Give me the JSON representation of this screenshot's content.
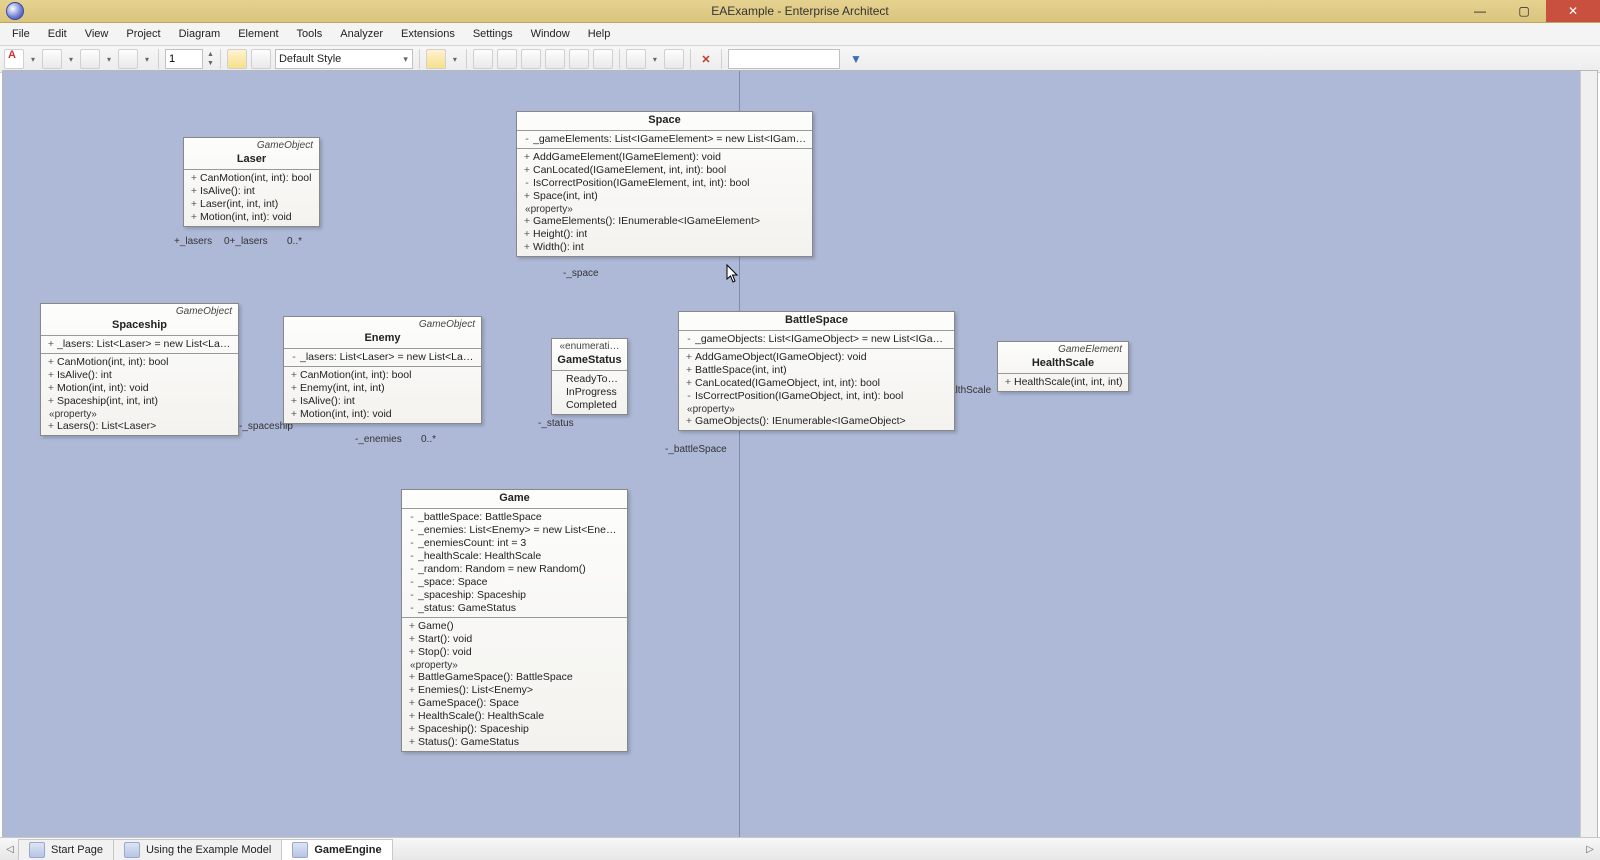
{
  "window": {
    "title": "EAExample - Enterprise Architect"
  },
  "menu": [
    "File",
    "Edit",
    "View",
    "Project",
    "Diagram",
    "Element",
    "Tools",
    "Analyzer",
    "Extensions",
    "Settings",
    "Window",
    "Help"
  ],
  "toolbar": {
    "spin_value": "1",
    "style_combo": "Default Style"
  },
  "tabs": [
    {
      "label": "Start Page",
      "active": false
    },
    {
      "label": "Using the Example Model",
      "active": false
    },
    {
      "label": "GameEngine",
      "active": true
    }
  ],
  "role_labels": {
    "lasers_left": "+_lasers",
    "lasers_mult": "0+_lasers",
    "lasers_star": "0..*",
    "spaceship": "-_spaceship",
    "enemies": "-_enemies",
    "enemies_mult": "0..*",
    "status": "-_status",
    "space": "-_space",
    "battleSpace": "-_battleSpace",
    "healthScale": "-_healthScale"
  },
  "classes": {
    "laser": {
      "stereo": "GameObject",
      "name": "Laser",
      "ops": [
        {
          "v": "+",
          "s": "CanMotion(int, int): bool"
        },
        {
          "v": "+",
          "s": "IsAlive(): int"
        },
        {
          "v": "+",
          "s": "Laser(int, int, int)"
        },
        {
          "v": "+",
          "s": "Motion(int, int): void"
        }
      ]
    },
    "space": {
      "stereo": "",
      "name": "Space",
      "attrs": [
        {
          "v": "-",
          "s": "_gameElements: List<IGameElement> = new List<IGameE..."
        }
      ],
      "ops": [
        {
          "v": "+",
          "s": "AddGameElement(IGameElement): void"
        },
        {
          "v": "+",
          "s": "CanLocated(IGameElement, int, int): bool"
        },
        {
          "v": "-",
          "s": "IsCorrectPosition(IGameElement, int, int): bool"
        },
        {
          "v": "+",
          "s": "Space(int, int)"
        }
      ],
      "prop_label": "property",
      "props": [
        {
          "v": "+",
          "s": "GameElements(): IEnumerable<IGameElement>"
        },
        {
          "v": "+",
          "s": "Height(): int"
        },
        {
          "v": "+",
          "s": "Width(): int"
        }
      ]
    },
    "spaceship": {
      "stereo": "GameObject",
      "name": "Spaceship",
      "attrs": [
        {
          "v": "+",
          "s": "_lasers: List<Laser> = new List<Laser>()"
        }
      ],
      "ops": [
        {
          "v": "+",
          "s": "CanMotion(int, int): bool"
        },
        {
          "v": "+",
          "s": "IsAlive(): int"
        },
        {
          "v": "+",
          "s": "Motion(int, int): void"
        },
        {
          "v": "+",
          "s": "Spaceship(int, int, int)"
        }
      ],
      "prop_label": "property",
      "props": [
        {
          "v": "+",
          "s": "Lasers(): List<Laser>"
        }
      ]
    },
    "enemy": {
      "stereo": "GameObject",
      "name": "Enemy",
      "attrs": [
        {
          "v": "-",
          "s": "_lasers: List<Laser> = new List<Laser>()"
        }
      ],
      "ops": [
        {
          "v": "+",
          "s": "CanMotion(int, int): bool"
        },
        {
          "v": "+",
          "s": "Enemy(int, int, int)"
        },
        {
          "v": "+",
          "s": "IsAlive(): int"
        },
        {
          "v": "+",
          "s": "Motion(int, int): void"
        }
      ]
    },
    "gamestatus": {
      "stereo": "enumerati",
      "name": "GameStatus",
      "literals": [
        "ReadyToStart",
        "InProgress",
        "Completed"
      ]
    },
    "battlespace": {
      "stereo": "",
      "name": "BattleSpace",
      "attrs": [
        {
          "v": "-",
          "s": "_gameObjects: List<IGameObject> = new List<IGameO..."
        }
      ],
      "ops": [
        {
          "v": "+",
          "s": "AddGameObject(IGameObject): void"
        },
        {
          "v": "+",
          "s": "BattleSpace(int, int)"
        },
        {
          "v": "+",
          "s": "CanLocated(IGameObject, int, int): bool"
        },
        {
          "v": "-",
          "s": "IsCorrectPosition(IGameObject, int, int): bool"
        }
      ],
      "prop_label": "property",
      "props": [
        {
          "v": "+",
          "s": "GameObjects(): IEnumerable<IGameObject>"
        }
      ]
    },
    "healthscale": {
      "stereo": "GameElement",
      "name": "HealthScale",
      "ops": [
        {
          "v": "+",
          "s": "HealthScale(int, int, int)"
        }
      ]
    },
    "game": {
      "stereo": "",
      "name": "Game",
      "attrs": [
        {
          "v": "-",
          "s": "_battleSpace: BattleSpace"
        },
        {
          "v": "-",
          "s": "_enemies: List<Enemy> = new List<Enemy>()"
        },
        {
          "v": "-",
          "s": "_enemiesCount: int = 3"
        },
        {
          "v": "-",
          "s": "_healthScale: HealthScale"
        },
        {
          "v": "-",
          "s": "_random: Random = new Random()"
        },
        {
          "v": "-",
          "s": "_space: Space"
        },
        {
          "v": "-",
          "s": "_spaceship: Spaceship"
        },
        {
          "v": "-",
          "s": "_status: GameStatus"
        }
      ],
      "ops": [
        {
          "v": "+",
          "s": "Game()"
        },
        {
          "v": "+",
          "s": "Start(): void"
        },
        {
          "v": "+",
          "s": "Stop(): void"
        }
      ],
      "prop_label": "property",
      "props": [
        {
          "v": "+",
          "s": "BattleGameSpace(): BattleSpace"
        },
        {
          "v": "+",
          "s": "Enemies(): List<Enemy>"
        },
        {
          "v": "+",
          "s": "GameSpace(): Space"
        },
        {
          "v": "+",
          "s": "HealthScale(): HealthScale"
        },
        {
          "v": "+",
          "s": "Spaceship(): Spaceship"
        },
        {
          "v": "+",
          "s": "Status(): GameStatus"
        }
      ]
    }
  }
}
